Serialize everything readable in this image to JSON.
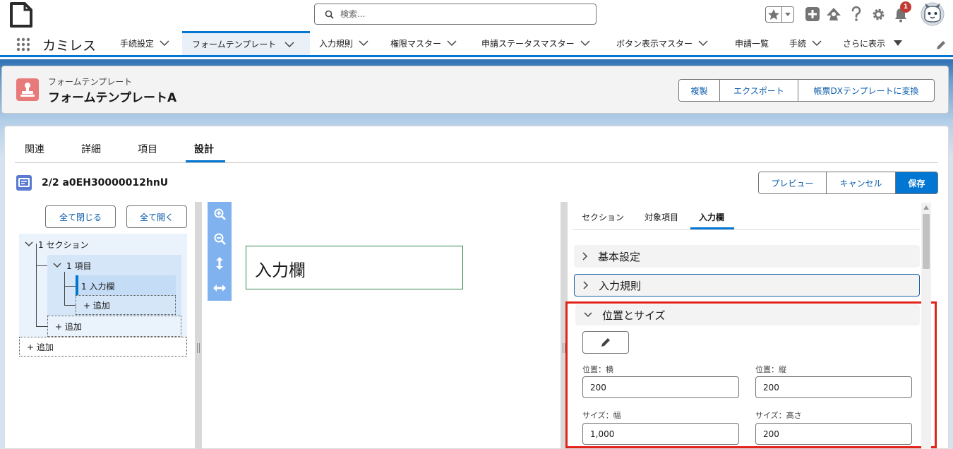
{
  "search": {
    "placeholder": "検索..."
  },
  "notifications": {
    "count": "1"
  },
  "nav": {
    "app_name": "カミレス",
    "tabs": [
      {
        "label": "手続設定"
      },
      {
        "label": "フォームテンプレート"
      },
      {
        "label": "入力規則"
      },
      {
        "label": "権限マスター"
      },
      {
        "label": "申請ステータスマスター"
      },
      {
        "label": "ボタン表示マスター"
      },
      {
        "label": "申請一覧"
      },
      {
        "label": "手続"
      },
      {
        "label": "さらに表示"
      }
    ]
  },
  "record": {
    "type": "フォームテンプレート",
    "name": "フォームテンプレートA",
    "actions": [
      "複製",
      "エクスポート",
      "帳票DXテンプレートに変換"
    ]
  },
  "record_tabs": [
    "関連",
    "詳細",
    "項目",
    "設計"
  ],
  "layout": {
    "title": "2/2 a0EH30000012hnU",
    "actions": [
      "プレビュー",
      "キャンセル",
      "保存"
    ]
  },
  "tree": {
    "collapse_all": "全て閉じる",
    "expand_all": "全て開く",
    "section": "1 セクション",
    "item": "1 項目",
    "field": "1 入力欄",
    "add_field": "+ 追加",
    "add_item": "+ 追加",
    "add_section": "+ 追加"
  },
  "canvas": {
    "field_label": "入力欄"
  },
  "props": {
    "tabs": [
      "セクション",
      "対象項目",
      "入力欄"
    ],
    "sections": {
      "basic": "基本設定",
      "rules": "入力規則",
      "position": "位置とサイズ"
    },
    "fields": {
      "pos_x_label": "位置：横",
      "pos_x": "200",
      "pos_y_label": "位置：縦",
      "pos_y": "200",
      "width_label": "サイズ：幅",
      "width": "1,000",
      "height_label": "サイズ：高さ",
      "height": "200"
    }
  },
  "colors": {
    "brand": "#0176d3",
    "highlight": "#e2231a",
    "record_icon": "#e97a7a"
  }
}
